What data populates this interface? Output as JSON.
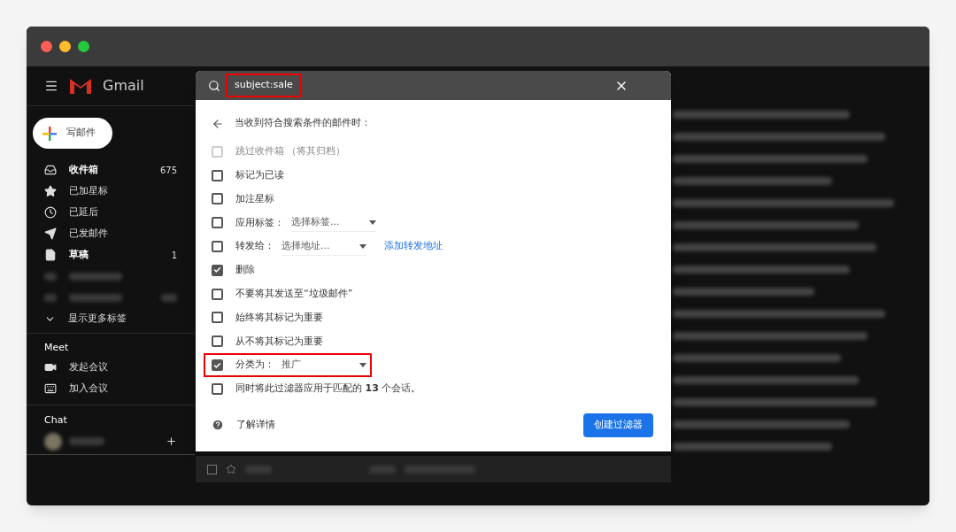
{
  "app": {
    "name": "Gmail"
  },
  "compose": {
    "label": "写邮件"
  },
  "sidebar": {
    "items": [
      {
        "kind": "inbox",
        "label": "收件箱",
        "count": "675",
        "bold": true
      },
      {
        "kind": "starred",
        "label": "已加星标",
        "bold": false
      },
      {
        "kind": "snoozed",
        "label": "已延后",
        "bold": false
      },
      {
        "kind": "sent",
        "label": "已发邮件",
        "bold": false
      },
      {
        "kind": "drafts",
        "label": "草稿",
        "count": "1",
        "bold": true
      }
    ],
    "more": "显示更多标签"
  },
  "meet": {
    "title": "Meet",
    "items": [
      {
        "kind": "video",
        "label": "发起会议"
      },
      {
        "kind": "keyboard",
        "label": "加入会议"
      }
    ]
  },
  "chat": {
    "title": "Chat"
  },
  "search": {
    "value": "subject:sale",
    "highlighted": true
  },
  "filter": {
    "heading": "当收到符合搜索条件的邮件时：",
    "options": [
      {
        "kind": "plain",
        "label": "跳过收件箱 （将其归档）",
        "checked": false,
        "disabled": true,
        "highlighted": false
      },
      {
        "kind": "plain",
        "label": "标记为已读",
        "checked": false,
        "disabled": false,
        "highlighted": false
      },
      {
        "kind": "plain",
        "label": "加注星标",
        "checked": false,
        "disabled": false,
        "highlighted": false
      },
      {
        "kind": "select",
        "label": "应用标签：",
        "value": "选择标签...",
        "checked": false,
        "disabled": false,
        "highlighted": false
      },
      {
        "kind": "select",
        "label": "转发给：",
        "value": "选择地址...",
        "link": "添加转发地址",
        "checked": false,
        "disabled": false,
        "highlighted": false
      },
      {
        "kind": "plain",
        "label": "删除",
        "checked": true,
        "disabled": false,
        "highlighted": false
      },
      {
        "kind": "plain",
        "label": "不要将其发送至“垃圾邮件”",
        "checked": false,
        "disabled": false,
        "highlighted": false
      },
      {
        "kind": "plain",
        "label": "始终将其标记为重要",
        "checked": false,
        "disabled": false,
        "highlighted": false
      },
      {
        "kind": "plain",
        "label": "从不将其标记为重要",
        "checked": false,
        "disabled": false,
        "highlighted": false
      },
      {
        "kind": "select",
        "label": "分类为：",
        "value": "推广",
        "checked": true,
        "disabled": false,
        "highlighted": true
      },
      {
        "kind": "plain",
        "label": "同时将此过滤器应用于匹配的 **13** 个会话。",
        "checked": false,
        "disabled": false,
        "highlighted": false
      }
    ],
    "help": "了解详情",
    "message_row": {
      "checked": false
    },
    "create_button": "创建过滤器"
  }
}
